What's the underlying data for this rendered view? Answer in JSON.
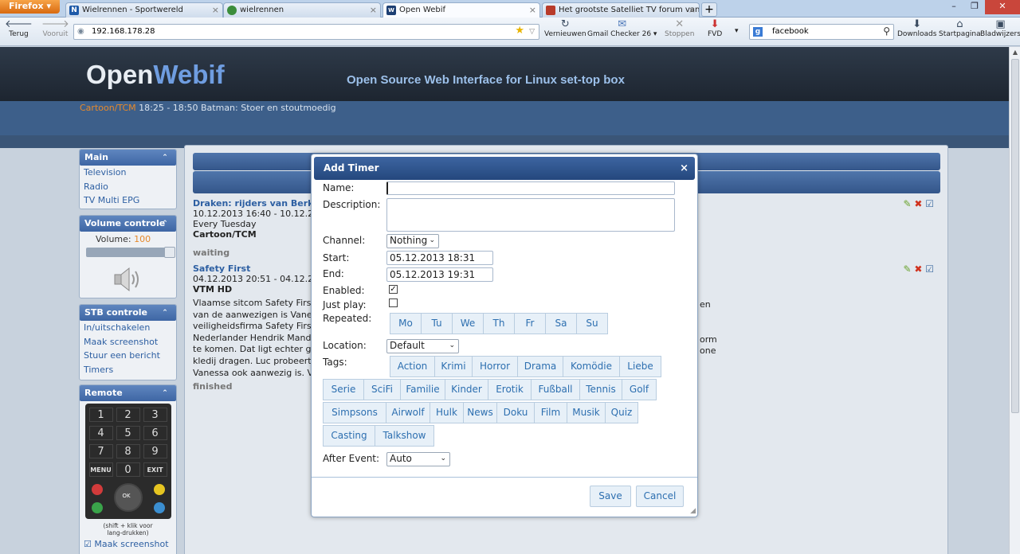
{
  "browser": {
    "menu_button": "Firefox",
    "tabs": [
      {
        "label": "Wielrennen - Sportwereld",
        "favicon": "letter-N",
        "favicon_color": "#1e5aa8"
      },
      {
        "label": "wielrennen",
        "favicon": "earth-icon",
        "favicon_color": "#3b8d3b"
      },
      {
        "label": "Open Webif",
        "favicon": "letter-OW",
        "favicon_color": "#1d3f73"
      },
      {
        "label": "Het grootste Satelliet TV forum van N...",
        "favicon": "tv-icon",
        "favicon_color": "#b83b2a"
      }
    ],
    "new_tab": "+",
    "nav": {
      "back": "Terug",
      "forward": "Vooruit",
      "reload": "Vernieuwen",
      "gmail": "Gmail Checker",
      "gmail_count": "26",
      "stop": "Stoppen",
      "fvd": "FVD",
      "downloads": "Downloads",
      "home": "Startpagina",
      "bookmarks": "Bladwijzers"
    },
    "url": "192.168.178.28",
    "search_value": "facebook"
  },
  "header": {
    "logo_part1": "Open",
    "logo_part2": "Webif",
    "tagline": "Open Source Web Interface for Linux set-top box"
  },
  "now_playing": {
    "channel": "Cartoon/TCM",
    "text": "18:25 - 18:50  Batman: Stoer en stoutmoedig"
  },
  "sidebar": {
    "main": {
      "title": "Main",
      "items": [
        "Television",
        "Radio",
        "TV Multi EPG"
      ]
    },
    "volume": {
      "title": "Volume controle",
      "label": "Volume:",
      "value": "100"
    },
    "stb": {
      "title": "STB controle",
      "items": [
        "In/uitschakelen",
        "Maak screenshot",
        "Stuur een bericht",
        "Timers"
      ]
    },
    "remote": {
      "title": "Remote",
      "keys": [
        "1",
        "2",
        "3",
        "4",
        "5",
        "6",
        "7",
        "8",
        "9",
        "MENU",
        "0",
        "EXIT"
      ],
      "ok": "OK",
      "note_line1": "(shift + klik voor",
      "note_line2": "lang-drukken)",
      "screenshot_label": "Maak screenshot"
    }
  },
  "timers": [
    {
      "title": "Draken: rijders van Berk",
      "time": "10.12.2013 16:40 - 10.12.2",
      "repeat": "Every Tuesday",
      "channel": "Cartoon/TCM",
      "status": "waiting"
    },
    {
      "title": "Safety First",
      "time": "04.12.2013 20:51 - 04.12.2",
      "channel": "VTM HD",
      "desc_lines": [
        "Vlaamse sitcom Safety Firs",
        "van de aanwezigen is Vane",
        "veiligheidsfirma Safety First",
        "Nederlander Hendrik Mande",
        "te komen. Dat ligt echter g",
        "kledij dragen. Luc probeert",
        "Vanessa ook aanwezig is. V"
      ],
      "desc_right": [
        "en",
        "",
        "",
        "orm",
        "one",
        "",
        ""
      ],
      "status": "finished"
    }
  ],
  "dialog": {
    "title": "Add Timer",
    "close": "×",
    "labels": {
      "name": "Name:",
      "description": "Description:",
      "channel": "Channel:",
      "start": "Start:",
      "end": "End:",
      "enabled": "Enabled:",
      "just_play": "Just play:",
      "repeated": "Repeated:",
      "location": "Location:",
      "tags": "Tags:",
      "after_event": "After Event:"
    },
    "name_value": "",
    "description_value": "",
    "channel_value": "Nothing",
    "start_value": "05.12.2013 18:31",
    "end_value": "05.12.2013 19:31",
    "enabled_checked": true,
    "just_play_checked": false,
    "days": [
      "Mo",
      "Tu",
      "We",
      "Th",
      "Fr",
      "Sa",
      "Su"
    ],
    "location_value": "Default",
    "tags_rows": [
      [
        "Action",
        "Krimi",
        "Horror",
        "Drama",
        "Komödie",
        "Liebe"
      ],
      [
        "Serie",
        "SciFi",
        "Familie",
        "Kinder",
        "Erotik",
        "Fußball",
        "Tennis",
        "Golf"
      ],
      [
        "Simpsons",
        "Airwolf",
        "Hulk",
        "News",
        "Doku",
        "Film",
        "Musik",
        "Quiz"
      ],
      [
        "Casting",
        "Talkshow"
      ]
    ],
    "after_event_value": "Auto",
    "save": "Save",
    "cancel": "Cancel"
  }
}
